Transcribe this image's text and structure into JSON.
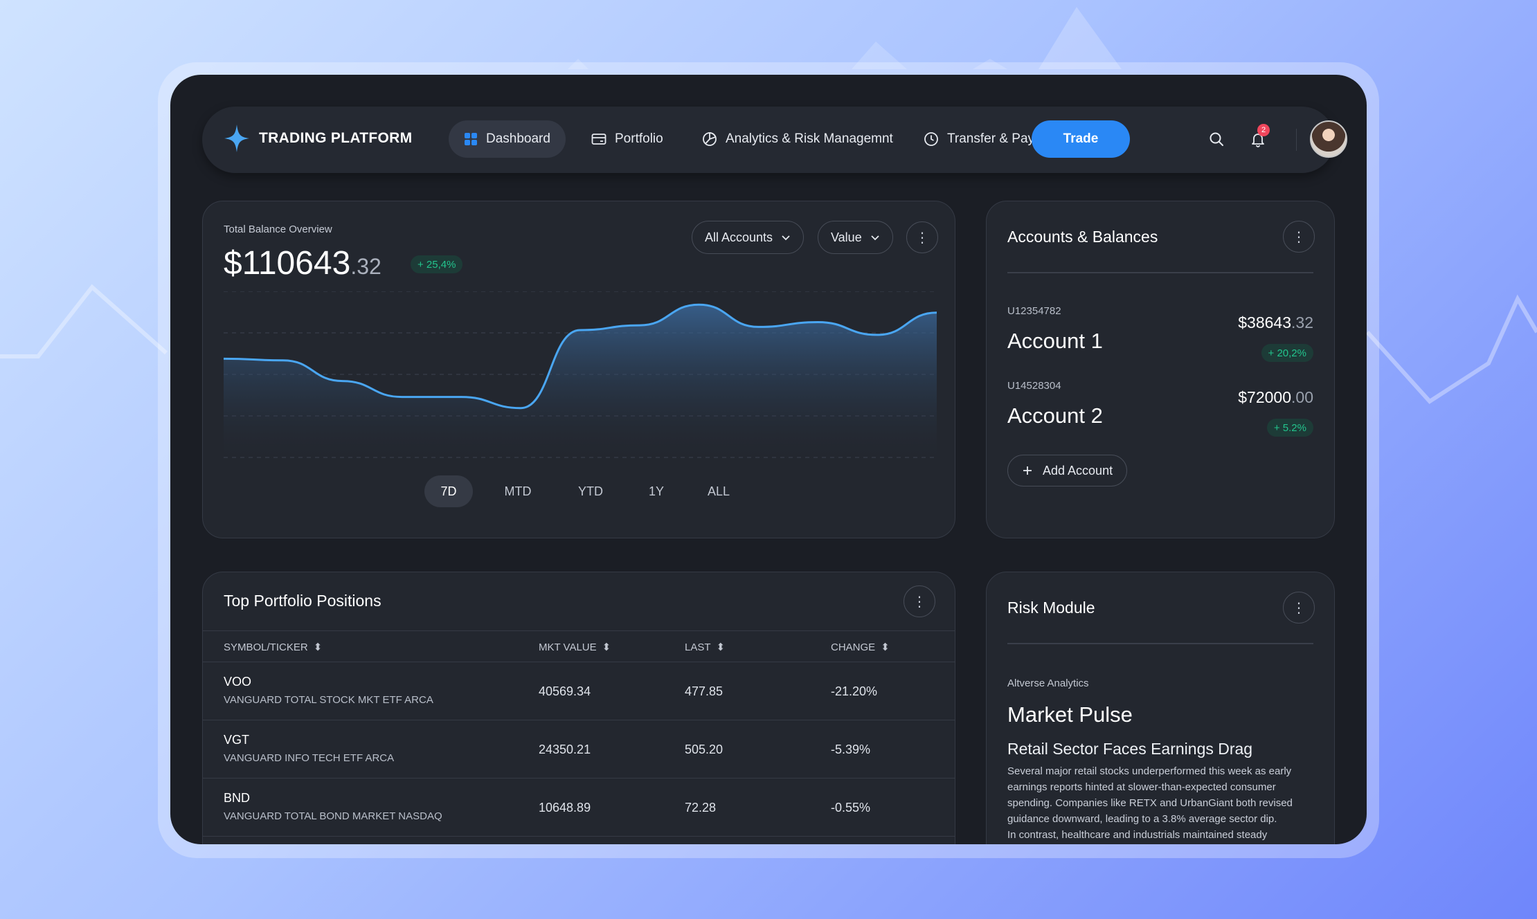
{
  "brand": {
    "name": "TRADING PLATFORM"
  },
  "nav": {
    "items": [
      {
        "label": "Dashboard",
        "icon": "grid-icon",
        "active": true
      },
      {
        "label": "Portfolio",
        "icon": "wallet-icon",
        "active": false
      },
      {
        "label": "Analytics & Risk Managemnt",
        "icon": "pie-chart-icon",
        "active": false
      },
      {
        "label": "Transfer & Pay",
        "icon": "clock-icon",
        "active": false
      }
    ],
    "trade_label": "Trade",
    "notification_count": "2"
  },
  "balance": {
    "title": "Total Balance Overview",
    "amount_whole": "$110643",
    "amount_cents": ".32",
    "change": "+ 25,4%",
    "filter_accounts": "All Accounts",
    "filter_metric": "Value",
    "ranges": [
      "7D",
      "MTD",
      "YTD",
      "1Y",
      "ALL"
    ],
    "active_range": "7D"
  },
  "chart_data": {
    "type": "area",
    "title": "",
    "xlabel": "",
    "ylabel": "",
    "grid": true,
    "values": [
      62,
      61,
      48,
      38,
      38,
      31,
      80,
      83,
      96,
      82,
      85,
      77,
      91
    ]
  },
  "accounts": {
    "title": "Accounts & Balances",
    "items": [
      {
        "id": "U12354782",
        "name": "Account 1",
        "value_whole": "$38643",
        "value_cents": ".32",
        "change": "+ 20,2%"
      },
      {
        "id": "U14528304",
        "name": "Account 2",
        "value_whole": "$72000",
        "value_cents": ".00",
        "change": "+ 5.2%"
      }
    ],
    "add_label": "Add Account"
  },
  "positions": {
    "title": "Top Portfolio Positions",
    "columns": [
      "SYMBOL/TICKER",
      "MKT VALUE",
      "LAST",
      "CHANGE"
    ],
    "rows": [
      {
        "symbol": "VOO",
        "name": "VANGUARD TOTAL STOCK MKT ETF ARCA",
        "mkt_value": "40569.34",
        "last": "477.85",
        "change": "-21.20%"
      },
      {
        "symbol": "VGT",
        "name": "VANGUARD INFO TECH ETF ARCA",
        "mkt_value": "24350.21",
        "last": "505.20",
        "change": "-5.39%"
      },
      {
        "symbol": "BND",
        "name": "VANGUARD TOTAL BOND MARKET NASDAQ",
        "mkt_value": "10648.89",
        "last": "72.28",
        "change": "-0.55%"
      }
    ]
  },
  "risk": {
    "title": "Risk Module",
    "source": "Altverse Analytics",
    "headline": "Market Pulse",
    "subheadline": "Retail Sector Faces Earnings Drag",
    "body": "Several major retail stocks underperformed this week as early earnings reports hinted at slower-than-expected consumer spending. Companies like RETX and UrbanGiant both revised guidance downward, leading to a 3.8% average sector dip.\n In contrast, healthcare and industrials maintained steady"
  },
  "colors": {
    "accent": "#2a88f5",
    "positive": "#23c48d",
    "badge": "#f0465c",
    "chart_line": "#4aa6f2"
  }
}
